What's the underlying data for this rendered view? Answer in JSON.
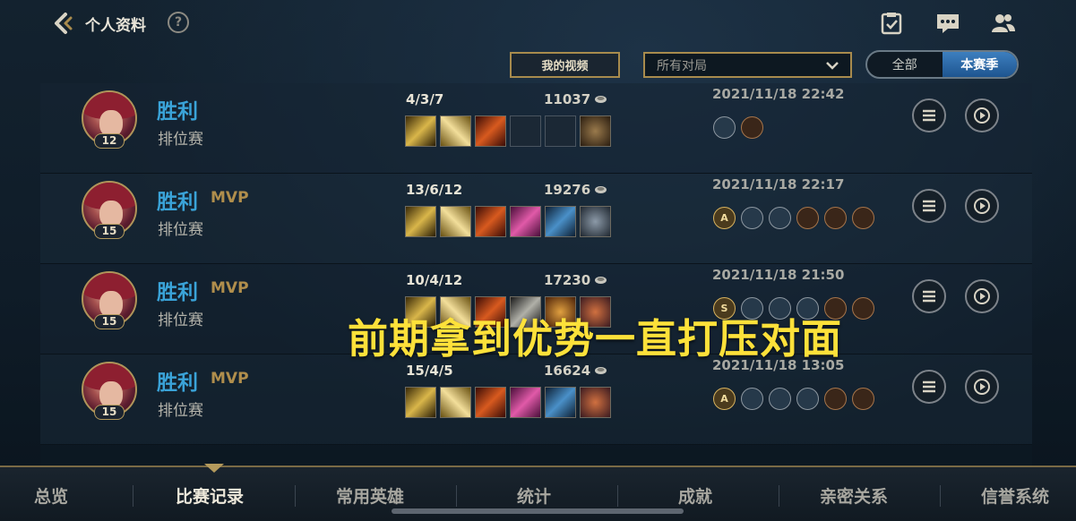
{
  "header": {
    "title": "个人资料",
    "help": "?"
  },
  "controls": {
    "video_label": "我的视频",
    "filter_value": "所有对局",
    "seg_all": "全部",
    "seg_season": "本赛季"
  },
  "matches": [
    {
      "result": "胜利",
      "mvp": "",
      "mode": "排位赛",
      "level": "12",
      "kda": "4/3/7",
      "gold": "11037",
      "date": "2021/11/18 22:42",
      "badges": [
        "",
        ""
      ]
    },
    {
      "result": "胜利",
      "mvp": "MVP",
      "mode": "排位赛",
      "level": "15",
      "kda": "13/6/12",
      "gold": "19276",
      "date": "2021/11/18 22:17",
      "badges": [
        "A",
        "",
        "",
        "",
        "",
        ""
      ]
    },
    {
      "result": "胜利",
      "mvp": "MVP",
      "mode": "排位赛",
      "level": "15",
      "kda": "10/4/12",
      "gold": "17230",
      "date": "2021/11/18 21:50",
      "badges": [
        "S",
        "",
        "",
        "",
        "",
        ""
      ]
    },
    {
      "result": "胜利",
      "mvp": "MVP",
      "mode": "排位赛",
      "level": "15",
      "kda": "15/4/5",
      "gold": "16624",
      "date": "2021/11/18 13:05",
      "badges": [
        "A",
        "",
        "",
        "",
        "",
        ""
      ]
    }
  ],
  "overlay_caption": "前期拿到优势一直打压对面",
  "bottom_nav": [
    "总览",
    "比赛记录",
    "常用英雄",
    "统计",
    "成就",
    "亲密关系",
    "信誉系统"
  ],
  "colors": {
    "win": "#3aa3d8",
    "mvp": "#b08e4c",
    "accent_gold": "#a88b4d",
    "caption": "#fde13a",
    "segment_active": "#2a6aa8"
  }
}
